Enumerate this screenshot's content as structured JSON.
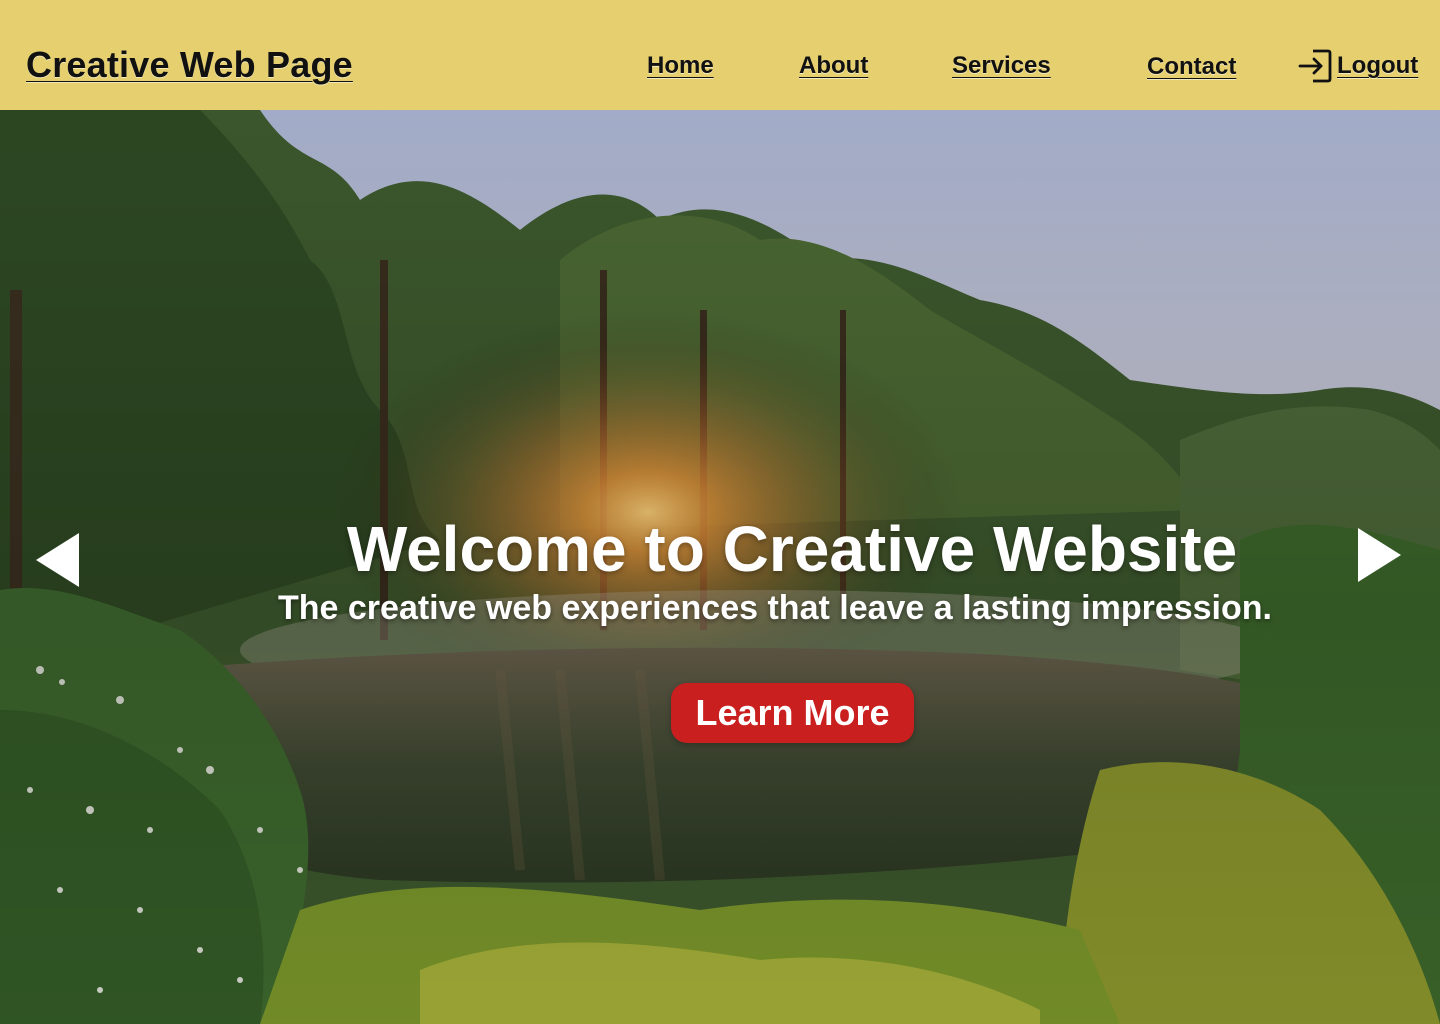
{
  "header": {
    "brand": "Creative Web Page",
    "nav": {
      "home": "Home",
      "about": "About",
      "services": "Services",
      "contact": "Contact"
    },
    "logout": {
      "label": "Logout",
      "icon": "logout-icon"
    },
    "background_color": "#e5cf6f"
  },
  "hero": {
    "title": "Welcome to Creative Website",
    "subtitle": "The creative web experiences that leave a lasting impression.",
    "cta_label": "Learn More",
    "cta_color": "#c9201f",
    "prev_icon": "arrow-left-icon",
    "next_icon": "arrow-right-icon",
    "image": "forest pond at sunrise"
  }
}
